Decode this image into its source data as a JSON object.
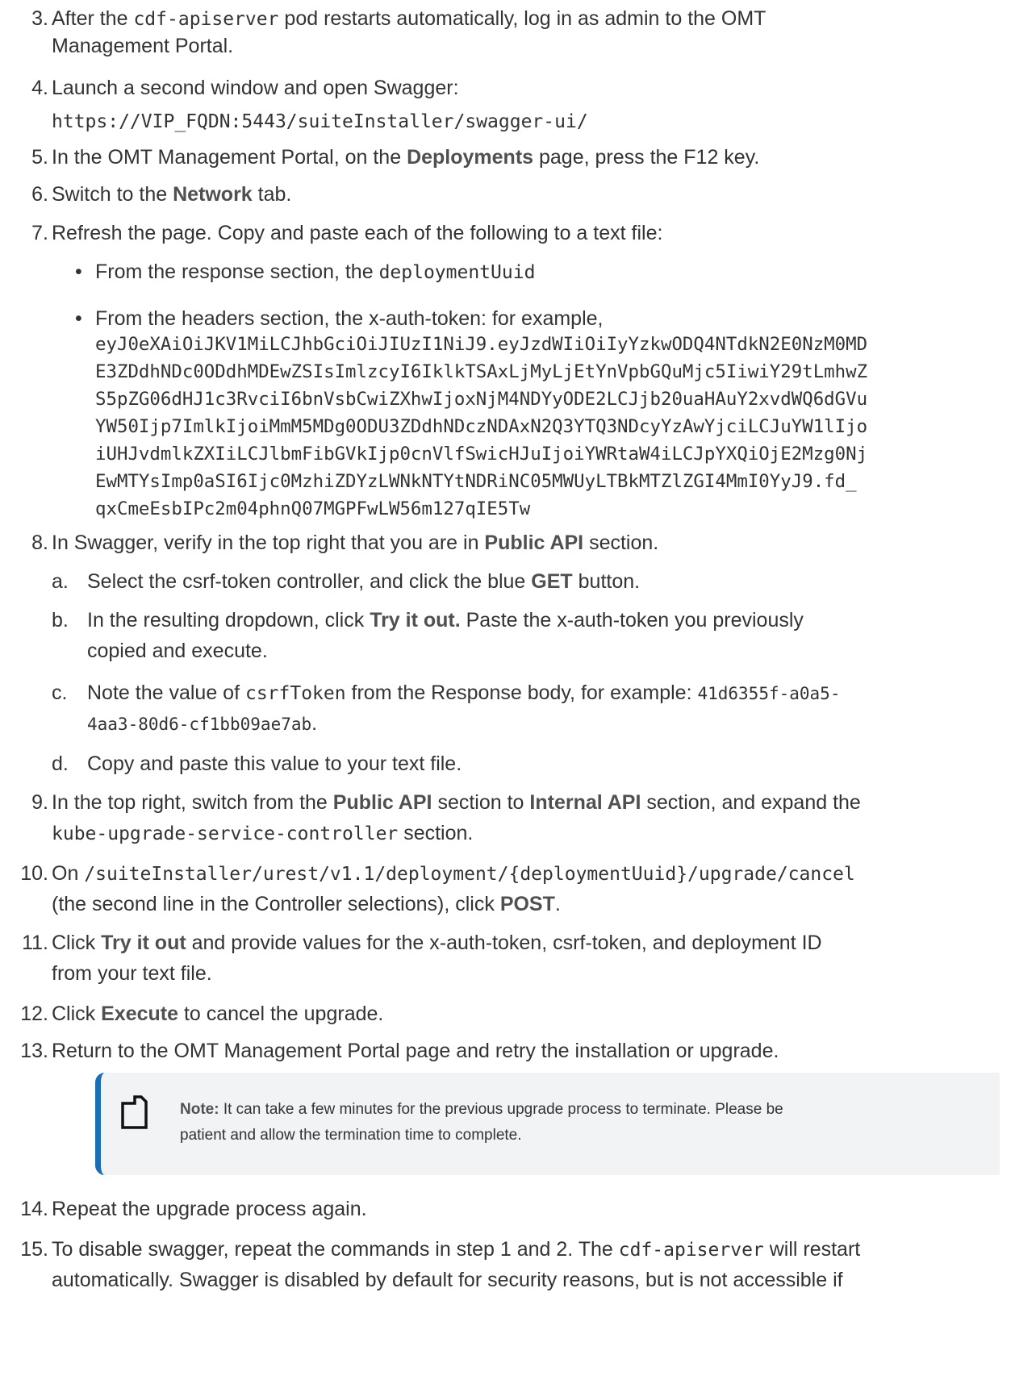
{
  "step3": {
    "num": "3.",
    "pre": "After the ",
    "code": "cdf-apiserver",
    "post": " pod restarts automatically, log in as admin to the OMT",
    "line2": "Management Portal."
  },
  "step4": {
    "num": "4.",
    "text": "Launch a second window and open Swagger:",
    "url": "https://VIP_FQDN:5443/suiteInstaller/swagger-ui/"
  },
  "step5": {
    "num": "5.",
    "pre": "In the OMT Management Portal, on the ",
    "bold": "Deployments",
    "post": " page, press the F12 key."
  },
  "step6": {
    "num": "6.",
    "pre": "Switch to the ",
    "bold": "Network",
    "post": " tab."
  },
  "step7": {
    "num": "7.",
    "text": "Refresh the page. Copy and paste each of the following to a text file:",
    "bullet1_pre": "From the response section, the ",
    "bullet1_code": "deploymentUuid",
    "bullet2": "From the headers section, the x-auth-token: for example,",
    "token_lines": [
      "eyJ0eXAiOiJKV1MiLCJhbGciOiJIUzI1NiJ9.eyJzdWIiOiIyYzkwODQ4NTdkN2E0NzM0MD",
      "E3ZDdhNDc0ODdhMDEwZSIsImlzcyI6IklkTSAxLjMyLjEtYnVpbGQuMjc5IiwiY29tLmhwZ",
      "S5pZG06dHJ1c3RvciI6bnVsbCwiZXhwIjoxNjM4NDYyODE2LCJjb20uaHAuY2xvdWQ6dGVu",
      "YW50Ijp7ImlkIjoiMmM5MDg0ODU3ZDdhNDczNDAxN2Q3YTQ3NDcyYzAwYjciLCJuYW1lIjo",
      "iUHJvdmlkZXIiLCJlbmFibGVkIjp0cnVlfSwicHJuIjoiYWRtaW4iLCJpYXQiOjE2Mzg0Nj",
      "EwMTYsImp0aSI6Ijc0MzhiZDYzLWNkNTYtNDRiNC05MWUyLTBkMTZlZGI4MmI0YyJ9.fd_",
      "qxCmeEsbIPc2m04phnQ07MGPFwLW56m127qIE5Tw"
    ]
  },
  "step8": {
    "num": "8.",
    "pre": "In Swagger, verify in the top right that you are in ",
    "bold": "Public API",
    "post": " section.",
    "a": {
      "label": "a.",
      "pre": "Select the csrf-token controller, and click the blue ",
      "bold": "GET",
      "post": " button."
    },
    "b": {
      "label": "b.",
      "pre": "In the resulting dropdown, click ",
      "bold": "Try it out.",
      "post": " Paste the x-auth-token you previously",
      "line2": "copied and execute."
    },
    "c": {
      "label": "c.",
      "pre": "Note the value of ",
      "code": "csrfToken",
      "mid": "  from the Response body, for example: ",
      "code2": "41d6355f-a0a5-",
      "line2": "4aa3-80d6-cf1bb09ae7ab",
      "line2_post": "."
    },
    "d": {
      "label": "d.",
      "text": "Copy and paste this value to your text file."
    }
  },
  "step9": {
    "num": "9.",
    "pre": "In the top right, switch from the ",
    "bold1": "Public API",
    "mid": " section to ",
    "bold2": "Internal API",
    "post": " section, and expand the",
    "code": "kube-upgrade-service-controller",
    "post2": " section."
  },
  "step10": {
    "num": "10.",
    "pre": "On ",
    "code": "/suiteInstaller/urest/v1.1/deployment/{deploymentUuid}/upgrade/cancel",
    "line2_pre": "(the second line in the Controller selections), click ",
    "bold": "POST",
    "line2_post": "."
  },
  "step11": {
    "num": "11.",
    "pre": "Click ",
    "bold": "Try it out",
    "post": " and provide values for the x-auth-token, csrf-token, and deployment ID",
    "line2": "from your text file."
  },
  "step12": {
    "num": "12.",
    "pre": "Click ",
    "bold": "Execute",
    "post": " to cancel the upgrade."
  },
  "step13": {
    "num": "13.",
    "text": "Return to the OMT Management Portal page and retry the installation or upgrade."
  },
  "note": {
    "label": "Note:",
    "line1": " It can take a few minutes for the previous upgrade process to terminate. Please be",
    "line2": "patient and allow the termination time to complete."
  },
  "step14": {
    "num": "14.",
    "text": "Repeat the upgrade process again."
  },
  "step15": {
    "num": "15.",
    "pre": "To disable swagger, repeat the commands in step 1 and 2. The ",
    "code": "cdf-apiserver",
    "post": " will restart",
    "line2": "automatically. Swagger is disabled by default for security reasons, but is not accessible if"
  },
  "colors": {
    "accent": "#1a6eb5",
    "note_bg": "#f2f3f5",
    "text": "#333333"
  }
}
